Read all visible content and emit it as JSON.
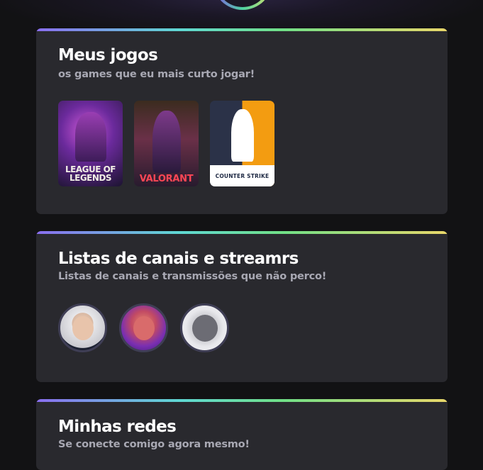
{
  "sections": {
    "games": {
      "title": "Meus jogos",
      "subtitle": "os games que eu mais curto jogar!",
      "items": [
        {
          "label": "LEAGUE OF\nLEGENDS",
          "icon": "league-of-legends-cover"
        },
        {
          "label": "VALORANT",
          "icon": "valorant-cover"
        },
        {
          "label": "COUNTER STRIKE",
          "icon": "counter-strike-cover"
        }
      ]
    },
    "streams": {
      "title": "Listas de canais e streamrs",
      "subtitle": "Listas de canais e transmissões que não perco!",
      "items": [
        {
          "icon": "streamer-avatar-1"
        },
        {
          "icon": "streamer-avatar-2"
        },
        {
          "icon": "streamer-avatar-tiger-logo"
        }
      ]
    },
    "socials": {
      "title": "Minhas redes",
      "subtitle": "Se conecte comigo agora mesmo!"
    }
  },
  "colors": {
    "background": "#121214",
    "card": "#29292e",
    "accent_gradient": [
      "#8a6ef0",
      "#5fd8d3",
      "#71e087",
      "#e9d76a"
    ],
    "subtitle": "#a8a8b3"
  }
}
